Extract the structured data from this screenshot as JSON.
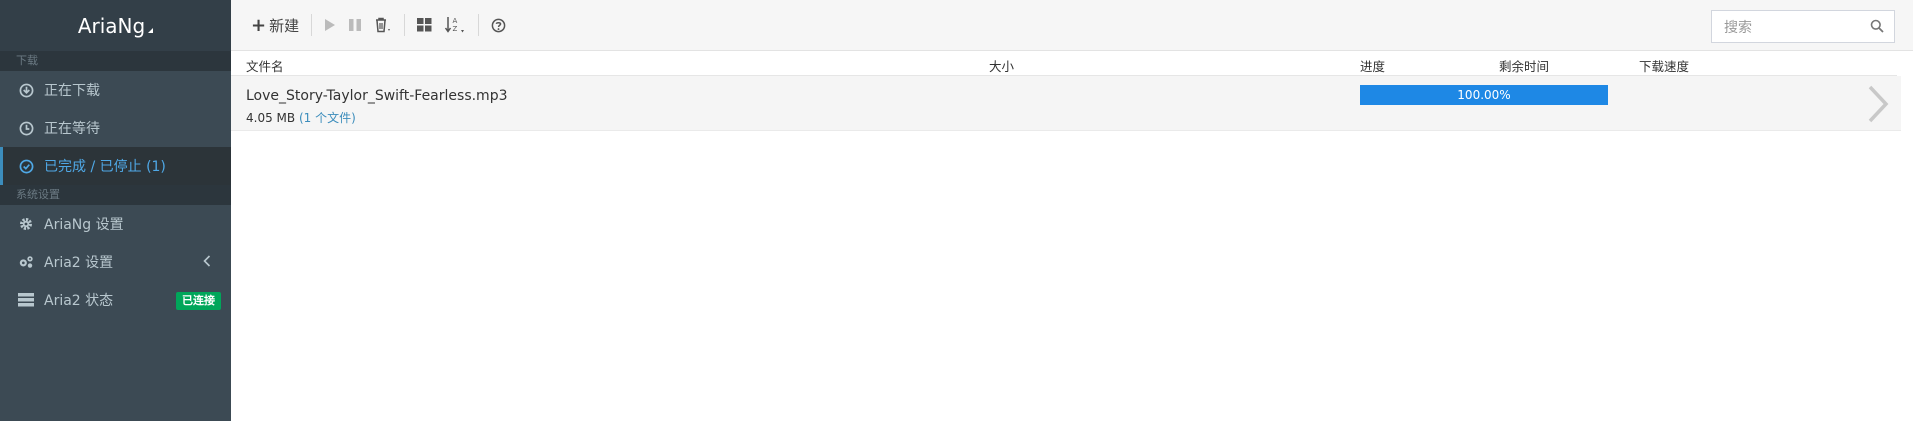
{
  "app": {
    "title": "AriaNg"
  },
  "sidebar": {
    "section_download": "下载",
    "section_settings": "系统设置",
    "items": [
      {
        "label": "正在下载",
        "icon": "download-circle-icon"
      },
      {
        "label": "正在等待",
        "icon": "clock-icon"
      },
      {
        "label": "已完成 / 已停止 (1)",
        "icon": "check-circle-icon"
      },
      {
        "label": "AriaNg 设置",
        "icon": "gear-icon"
      },
      {
        "label": "Aria2 设置",
        "icon": "gears-icon"
      },
      {
        "label": "Aria2 状态",
        "icon": "server-icon",
        "badge": "已连接"
      }
    ]
  },
  "toolbar": {
    "new_label": "新建",
    "search_placeholder": "搜索"
  },
  "table": {
    "headers": {
      "name": "文件名",
      "size": "大小",
      "progress": "进度",
      "remaining": "剩余时间",
      "speed": "下载速度"
    },
    "rows": [
      {
        "name": "Love_Story-Taylor_Swift-Fearless.mp3",
        "size": "4.05 MB",
        "file_count": "(1 个文件)",
        "progress": "100.00%",
        "progress_value": 1.0
      }
    ]
  },
  "colors": {
    "accent": "#3c8dbc",
    "progress": "#1e88e5",
    "badge": "#00a65a",
    "sidebar": "#3c4a54"
  }
}
